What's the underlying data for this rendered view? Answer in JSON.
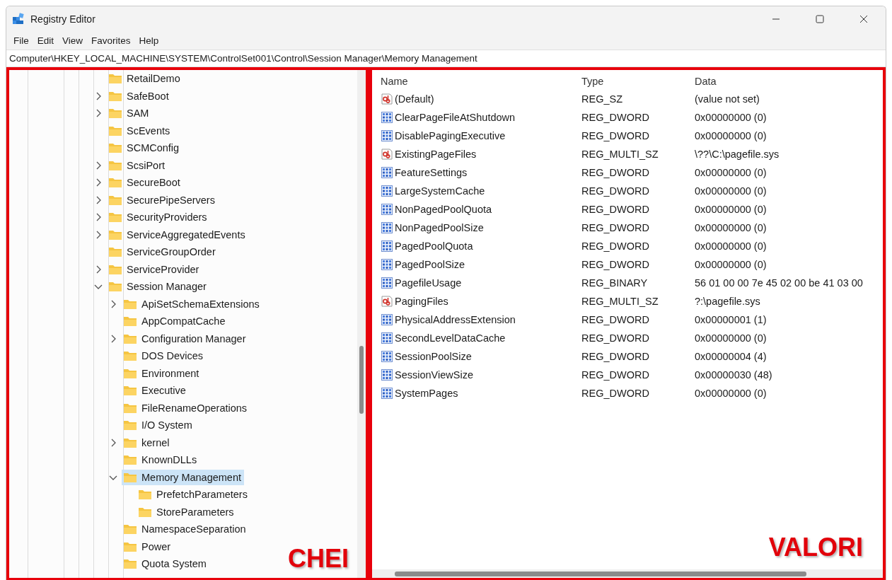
{
  "window": {
    "title": "Registry Editor"
  },
  "menu": [
    "File",
    "Edit",
    "View",
    "Favorites",
    "Help"
  ],
  "address": "Computer\\HKEY_LOCAL_MACHINE\\SYSTEM\\ControlSet001\\Control\\Session Manager\\Memory Management",
  "tree": [
    {
      "label": "RetailDemo",
      "expandable": false,
      "expanded": false,
      "selected": false
    },
    {
      "label": "SafeBoot",
      "expandable": true,
      "expanded": false,
      "selected": false
    },
    {
      "label": "SAM",
      "expandable": true,
      "expanded": false,
      "selected": false
    },
    {
      "label": "ScEvents",
      "expandable": false,
      "expanded": false,
      "selected": false
    },
    {
      "label": "SCMConfig",
      "expandable": false,
      "expanded": false,
      "selected": false
    },
    {
      "label": "ScsiPort",
      "expandable": true,
      "expanded": false,
      "selected": false
    },
    {
      "label": "SecureBoot",
      "expandable": true,
      "expanded": false,
      "selected": false
    },
    {
      "label": "SecurePipeServers",
      "expandable": true,
      "expanded": false,
      "selected": false
    },
    {
      "label": "SecurityProviders",
      "expandable": true,
      "expanded": false,
      "selected": false
    },
    {
      "label": "ServiceAggregatedEvents",
      "expandable": true,
      "expanded": false,
      "selected": false
    },
    {
      "label": "ServiceGroupOrder",
      "expandable": false,
      "expanded": false,
      "selected": false
    },
    {
      "label": "ServiceProvider",
      "expandable": true,
      "expanded": false,
      "selected": false
    },
    {
      "label": "Session Manager",
      "expandable": true,
      "expanded": true,
      "selected": false,
      "children": [
        {
          "label": "ApiSetSchemaExtensions",
          "expandable": true,
          "expanded": false,
          "selected": false
        },
        {
          "label": "AppCompatCache",
          "expandable": false,
          "expanded": false,
          "selected": false
        },
        {
          "label": "Configuration Manager",
          "expandable": true,
          "expanded": false,
          "selected": false
        },
        {
          "label": "DOS Devices",
          "expandable": false,
          "expanded": false,
          "selected": false
        },
        {
          "label": "Environment",
          "expandable": false,
          "expanded": false,
          "selected": false
        },
        {
          "label": "Executive",
          "expandable": false,
          "expanded": false,
          "selected": false
        },
        {
          "label": "FileRenameOperations",
          "expandable": false,
          "expanded": false,
          "selected": false
        },
        {
          "label": "I/O System",
          "expandable": false,
          "expanded": false,
          "selected": false
        },
        {
          "label": "kernel",
          "expandable": true,
          "expanded": false,
          "selected": false
        },
        {
          "label": "KnownDLLs",
          "expandable": false,
          "expanded": false,
          "selected": false
        },
        {
          "label": "Memory Management",
          "expandable": true,
          "expanded": true,
          "selected": true,
          "children": [
            {
              "label": "PrefetchParameters",
              "expandable": false,
              "expanded": false,
              "selected": false
            },
            {
              "label": "StoreParameters",
              "expandable": false,
              "expanded": false,
              "selected": false
            }
          ]
        },
        {
          "label": "NamespaceSeparation",
          "expandable": false,
          "expanded": false,
          "selected": false
        },
        {
          "label": "Power",
          "expandable": false,
          "expanded": false,
          "selected": false
        },
        {
          "label": "Quota System",
          "expandable": false,
          "expanded": false,
          "selected": false
        }
      ]
    }
  ],
  "values": {
    "columns": [
      "Name",
      "Type",
      "Data"
    ],
    "rows": [
      {
        "kind": "string",
        "name": "(Default)",
        "type": "REG_SZ",
        "data": "(value not set)"
      },
      {
        "kind": "binary",
        "name": "ClearPageFileAtShutdown",
        "type": "REG_DWORD",
        "data": "0x00000000 (0)"
      },
      {
        "kind": "binary",
        "name": "DisablePagingExecutive",
        "type": "REG_DWORD",
        "data": "0x00000000 (0)"
      },
      {
        "kind": "string",
        "name": "ExistingPageFiles",
        "type": "REG_MULTI_SZ",
        "data": "\\??\\C:\\pagefile.sys"
      },
      {
        "kind": "binary",
        "name": "FeatureSettings",
        "type": "REG_DWORD",
        "data": "0x00000000 (0)"
      },
      {
        "kind": "binary",
        "name": "LargeSystemCache",
        "type": "REG_DWORD",
        "data": "0x00000000 (0)"
      },
      {
        "kind": "binary",
        "name": "NonPagedPoolQuota",
        "type": "REG_DWORD",
        "data": "0x00000000 (0)"
      },
      {
        "kind": "binary",
        "name": "NonPagedPoolSize",
        "type": "REG_DWORD",
        "data": "0x00000000 (0)"
      },
      {
        "kind": "binary",
        "name": "PagedPoolQuota",
        "type": "REG_DWORD",
        "data": "0x00000000 (0)"
      },
      {
        "kind": "binary",
        "name": "PagedPoolSize",
        "type": "REG_DWORD",
        "data": "0x00000000 (0)"
      },
      {
        "kind": "binary",
        "name": "PagefileUsage",
        "type": "REG_BINARY",
        "data": "56 01 00 00 7e 45 02 00 be 41 03 00"
      },
      {
        "kind": "string",
        "name": "PagingFiles",
        "type": "REG_MULTI_SZ",
        "data": "?:\\pagefile.sys"
      },
      {
        "kind": "binary",
        "name": "PhysicalAddressExtension",
        "type": "REG_DWORD",
        "data": "0x00000001 (1)"
      },
      {
        "kind": "binary",
        "name": "SecondLevelDataCache",
        "type": "REG_DWORD",
        "data": "0x00000000 (0)"
      },
      {
        "kind": "binary",
        "name": "SessionPoolSize",
        "type": "REG_DWORD",
        "data": "0x00000004 (4)"
      },
      {
        "kind": "binary",
        "name": "SessionViewSize",
        "type": "REG_DWORD",
        "data": "0x00000030 (48)"
      },
      {
        "kind": "binary",
        "name": "SystemPages",
        "type": "REG_DWORD",
        "data": "0x00000000 (0)"
      }
    ]
  },
  "annotations": {
    "keys_label": "CHEI",
    "values_label": "VALORI"
  }
}
